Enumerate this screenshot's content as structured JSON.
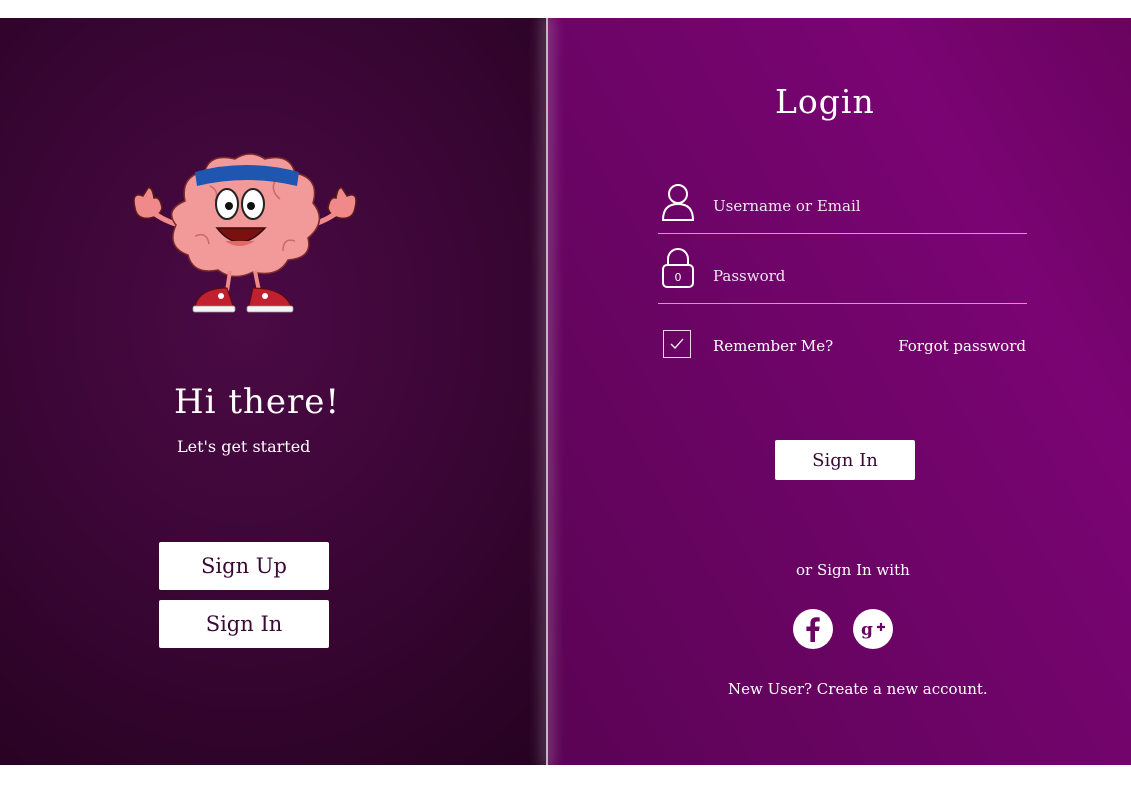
{
  "left": {
    "greeting": "Hi there!",
    "subtitle": "Let's get started",
    "signup_label": "Sign Up",
    "signin_label": "Sign In"
  },
  "login": {
    "title": "Login",
    "username_placeholder": "Username or Email",
    "password_placeholder": "Password",
    "remember_label": "Remember Me?",
    "remember_checked": true,
    "forgot_label": "Forgot password",
    "signin_label": "Sign In",
    "or_label": "or Sign In with",
    "social": [
      "facebook-icon",
      "google-plus-icon"
    ],
    "new_user_label": "New User? Create a new account."
  },
  "colors": {
    "left_bg": "#3b0636",
    "right_bg": "#6d0467",
    "button_bg": "#ffffff",
    "button_text": "#3a0a35"
  }
}
